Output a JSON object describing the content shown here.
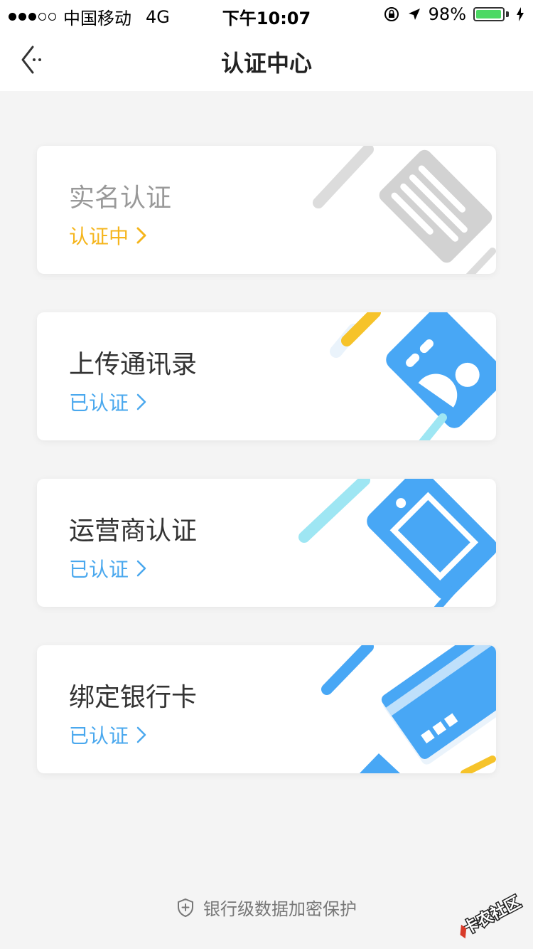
{
  "status_bar": {
    "carrier": "中国移动",
    "network": "4G",
    "time": "下午10:07",
    "battery_percent": "98%",
    "battery_level": 0.98
  },
  "header": {
    "title": "认证中心",
    "back_icon": "back-arrow-icon"
  },
  "cards": [
    {
      "title": "实名认证",
      "status": "认证中",
      "status_color": "#f5b51c",
      "icon": "id-document-icon"
    },
    {
      "title": "上传通讯录",
      "status": "已认证",
      "status_color": "#4aa8ee",
      "icon": "contacts-icon"
    },
    {
      "title": "运营商认证",
      "status": "已认证",
      "status_color": "#4aa8ee",
      "icon": "phone-icon"
    },
    {
      "title": "绑定银行卡",
      "status": "已认证",
      "status_color": "#4aa8ee",
      "icon": "bank-card-icon"
    }
  ],
  "footer": {
    "text": "银行级数据加密保护",
    "icon": "shield-icon"
  },
  "watermark": {
    "text": "卡农社区"
  },
  "colors": {
    "accent_blue": "#4aa8ee",
    "pending_yellow": "#f5b51c",
    "background": "#f4f4f4"
  }
}
